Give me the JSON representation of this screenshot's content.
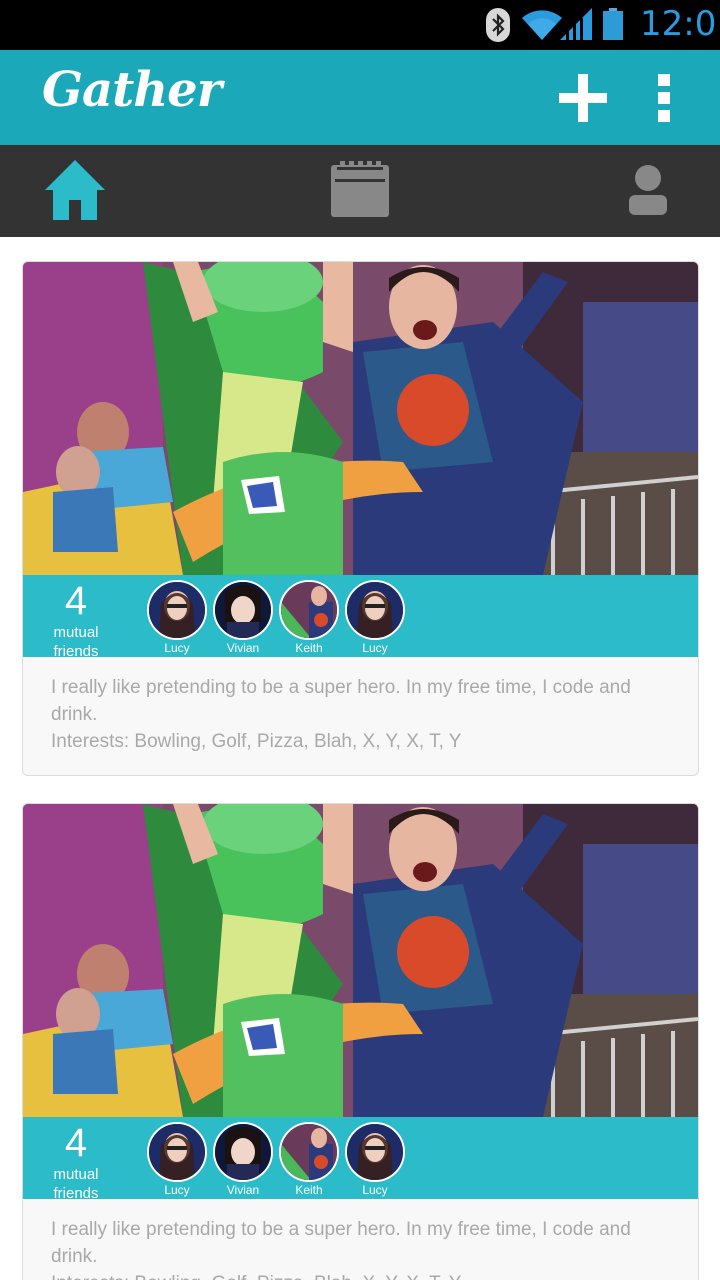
{
  "status_bar": {
    "time": "12:0",
    "icons": [
      "bluetooth-icon",
      "wifi-icon",
      "signal-icon",
      "battery-icon"
    ]
  },
  "app_bar": {
    "title": "Gather",
    "actions": [
      "add-icon",
      "overflow-menu-icon"
    ],
    "color": "#1ba9b9"
  },
  "tabs": [
    {
      "icon": "home-icon",
      "selected": true
    },
    {
      "icon": "calendar-icon",
      "selected": false
    },
    {
      "icon": "profile-icon",
      "selected": false
    }
  ],
  "cards": [
    {
      "mutual_count": "4",
      "mutual_label_1": "mutual",
      "mutual_label_2": "friends",
      "friends": [
        {
          "name": "Lucy"
        },
        {
          "name": "Vivian"
        },
        {
          "name": "Keith"
        },
        {
          "name": "Lucy"
        }
      ],
      "bio": "I really like pretending to be a super hero. In my free time, I code and drink.",
      "interests": "Interests: Bowling, Golf, Pizza, Blah, X, Y, X, T, Y"
    },
    {
      "mutual_count": "4",
      "mutual_label_1": "mutual",
      "mutual_label_2": "friends",
      "friends": [
        {
          "name": "Lucy"
        },
        {
          "name": "Vivian"
        },
        {
          "name": "Keith"
        },
        {
          "name": "Lucy"
        }
      ],
      "bio": "I really like pretending to be a super hero. In my free time, I code and drink.",
      "interests": "Interests: Bowling, Golf, Pizza, Blah, X, Y, X, T, Y"
    }
  ]
}
